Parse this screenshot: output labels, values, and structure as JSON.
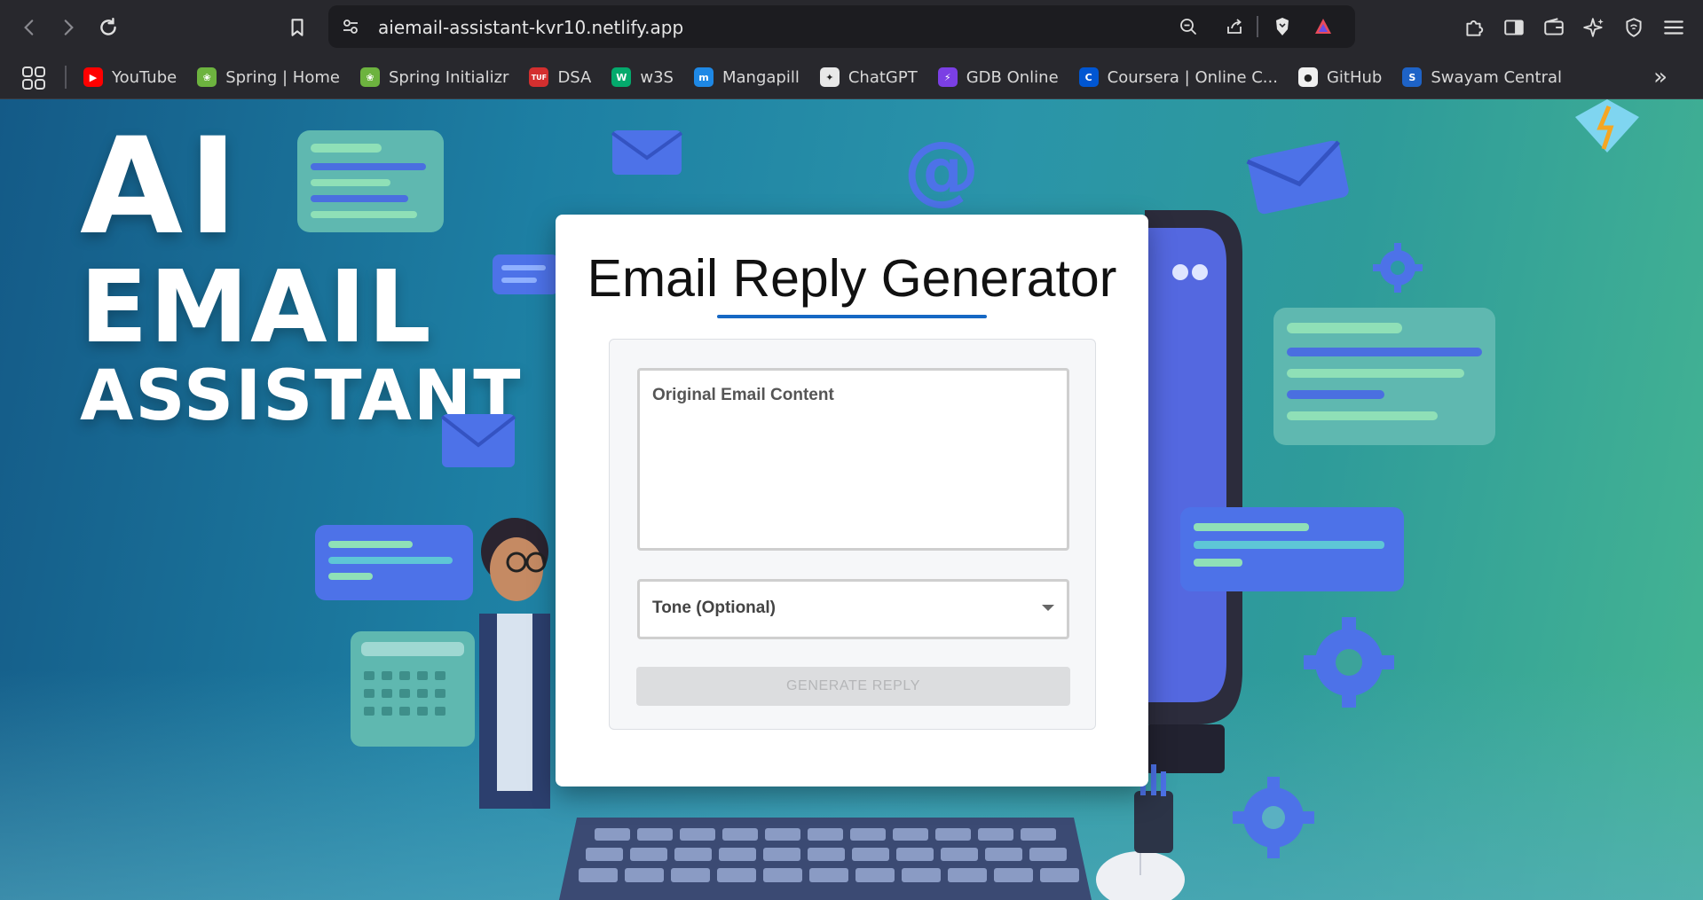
{
  "browser": {
    "url": "aiemail-assistant-kvr10.netlify.app",
    "bookmarks": [
      {
        "label": "YouTube",
        "favicon": "youtube-icon",
        "color": "#ff0000",
        "glyph": "▶"
      },
      {
        "label": "Spring | Home",
        "favicon": "spring-icon",
        "color": "#6db33f",
        "glyph": "❀"
      },
      {
        "label": "Spring Initializr",
        "favicon": "spring-icon",
        "color": "#6db33f",
        "glyph": "❀"
      },
      {
        "label": "DSA",
        "favicon": "tuf-icon",
        "color": "#d32f2f",
        "glyph": "TUF"
      },
      {
        "label": "w3S",
        "favicon": "w3schools-icon",
        "color": "#04aa6d",
        "glyph": "W"
      },
      {
        "label": "Mangapill",
        "favicon": "mangapill-icon",
        "color": "#1e88e5",
        "glyph": "m"
      },
      {
        "label": "ChatGPT",
        "favicon": "chatgpt-icon",
        "color": "#e8e8e8",
        "glyph": "✦"
      },
      {
        "label": "GDB Online",
        "favicon": "gdb-icon",
        "color": "#7b3fe4",
        "glyph": "⚡"
      },
      {
        "label": "Coursera | Online C...",
        "favicon": "coursera-icon",
        "color": "#0056d2",
        "glyph": "C"
      },
      {
        "label": "GitHub",
        "favicon": "github-icon",
        "color": "#f0f0f0",
        "glyph": "●"
      },
      {
        "label": "Swayam Central",
        "favicon": "swayam-icon",
        "color": "#1e63c7",
        "glyph": "S"
      }
    ]
  },
  "hero": {
    "line1": "AI",
    "line2": "EMAIL",
    "line3": "ASSISTANT"
  },
  "app": {
    "title": "Email Reply Generator",
    "email_placeholder": "Original Email Content",
    "tone_placeholder": "Tone (Optional)",
    "generate_label": "GENERATE REPLY"
  },
  "colors": {
    "accent": "#1668c4",
    "disabled_button": "#dcdddf"
  }
}
